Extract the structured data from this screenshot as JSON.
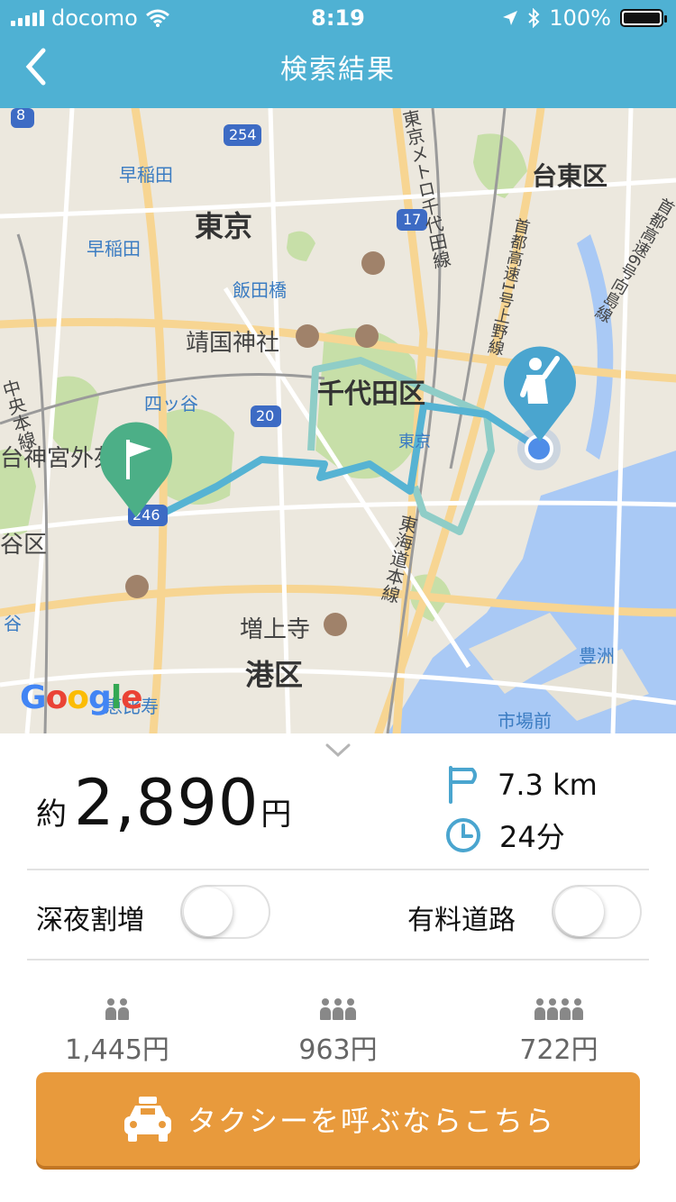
{
  "status_bar": {
    "carrier": "docomo",
    "time": "8:19",
    "battery_percent": "100%"
  },
  "header": {
    "title": "検索結果",
    "background_color": "#4fb1d3"
  },
  "map": {
    "labels": {
      "tokyo": "東京",
      "chiyoda": "千代田区",
      "taito": "台東区",
      "minato": "港区",
      "waseda_station": "早稲田",
      "waseda": "早稲田",
      "iidabashi": "飯田橋",
      "yasukuni": "靖国神社",
      "yotsuya": "四ッ谷",
      "tokyo_station": "東京",
      "zojoji": "増上寺",
      "toyosu": "豊洲",
      "shijomae": "市場前",
      "ebisu": "恵比寿",
      "meiji_jingu": "台神宮外苑",
      "shibuya_partial": "谷区",
      "chuo_line": "中央本線",
      "metro_chiyoda": "東京メトロ千代田線",
      "tokaido": "東海道本線",
      "expressway1": "首都高速1号上野線",
      "expressway6": "首都高速6号向島線",
      "route_8": "8",
      "route_254": "254",
      "route_17": "17",
      "route_20": "20",
      "route_246": "246",
      "left_edge_station": "谷",
      "google_logo": "Google"
    },
    "route_color": "#56b3d3",
    "alt_route_color": "#8fcdc7",
    "start_pin_color": "#4caf87",
    "end_pin_color": "#4aa5cf"
  },
  "summary": {
    "price_prefix": "約",
    "price_value": "2,890",
    "price_unit": "円",
    "distance": "7.3 km",
    "duration": "24分",
    "icon_color": "#4aa5cf"
  },
  "options": {
    "late_night_label": "深夜割増",
    "late_night_on": false,
    "toll_label": "有料道路",
    "toll_on": false
  },
  "split": [
    {
      "people": 2,
      "amount": "1,445円"
    },
    {
      "people": 3,
      "amount": "963円"
    },
    {
      "people": 4,
      "amount": "722円"
    }
  ],
  "cta": {
    "label": "タクシーを呼ぶならこちら",
    "color": "#e89a3c"
  }
}
